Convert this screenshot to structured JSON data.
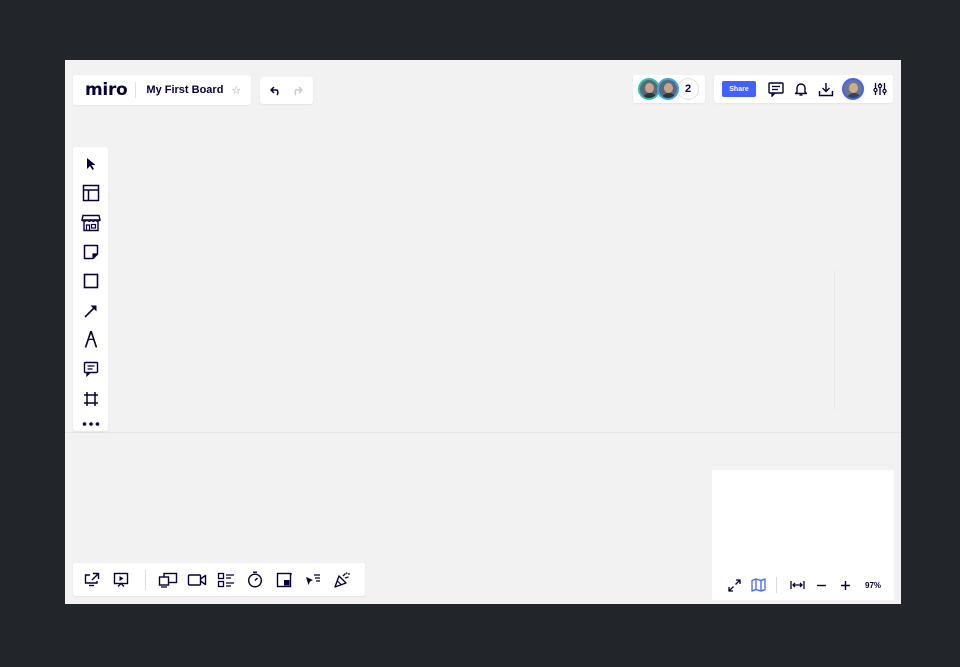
{
  "app": {
    "logo": "miro",
    "board_name": "My First Board"
  },
  "header": {
    "collaborators": {
      "count": "2",
      "avatars": [
        "collaborator-1",
        "collaborator-2"
      ]
    },
    "share_label": "Share"
  },
  "toolbar": {
    "tools": [
      "select",
      "templates",
      "marketplace",
      "sticky-note",
      "shape",
      "arrow",
      "pen",
      "comment",
      "frame",
      "more"
    ]
  },
  "bottom_toolbar": {
    "tools": [
      "share-screen",
      "presentation",
      "screen-share",
      "video-call",
      "cards",
      "timer",
      "embed",
      "cursor-focus",
      "celebrate"
    ]
  },
  "zoom": {
    "level": "97%"
  },
  "colors": {
    "accent": "#4262ff",
    "ink": "#050038",
    "background": "#222529",
    "board": "#f2f2f2"
  }
}
